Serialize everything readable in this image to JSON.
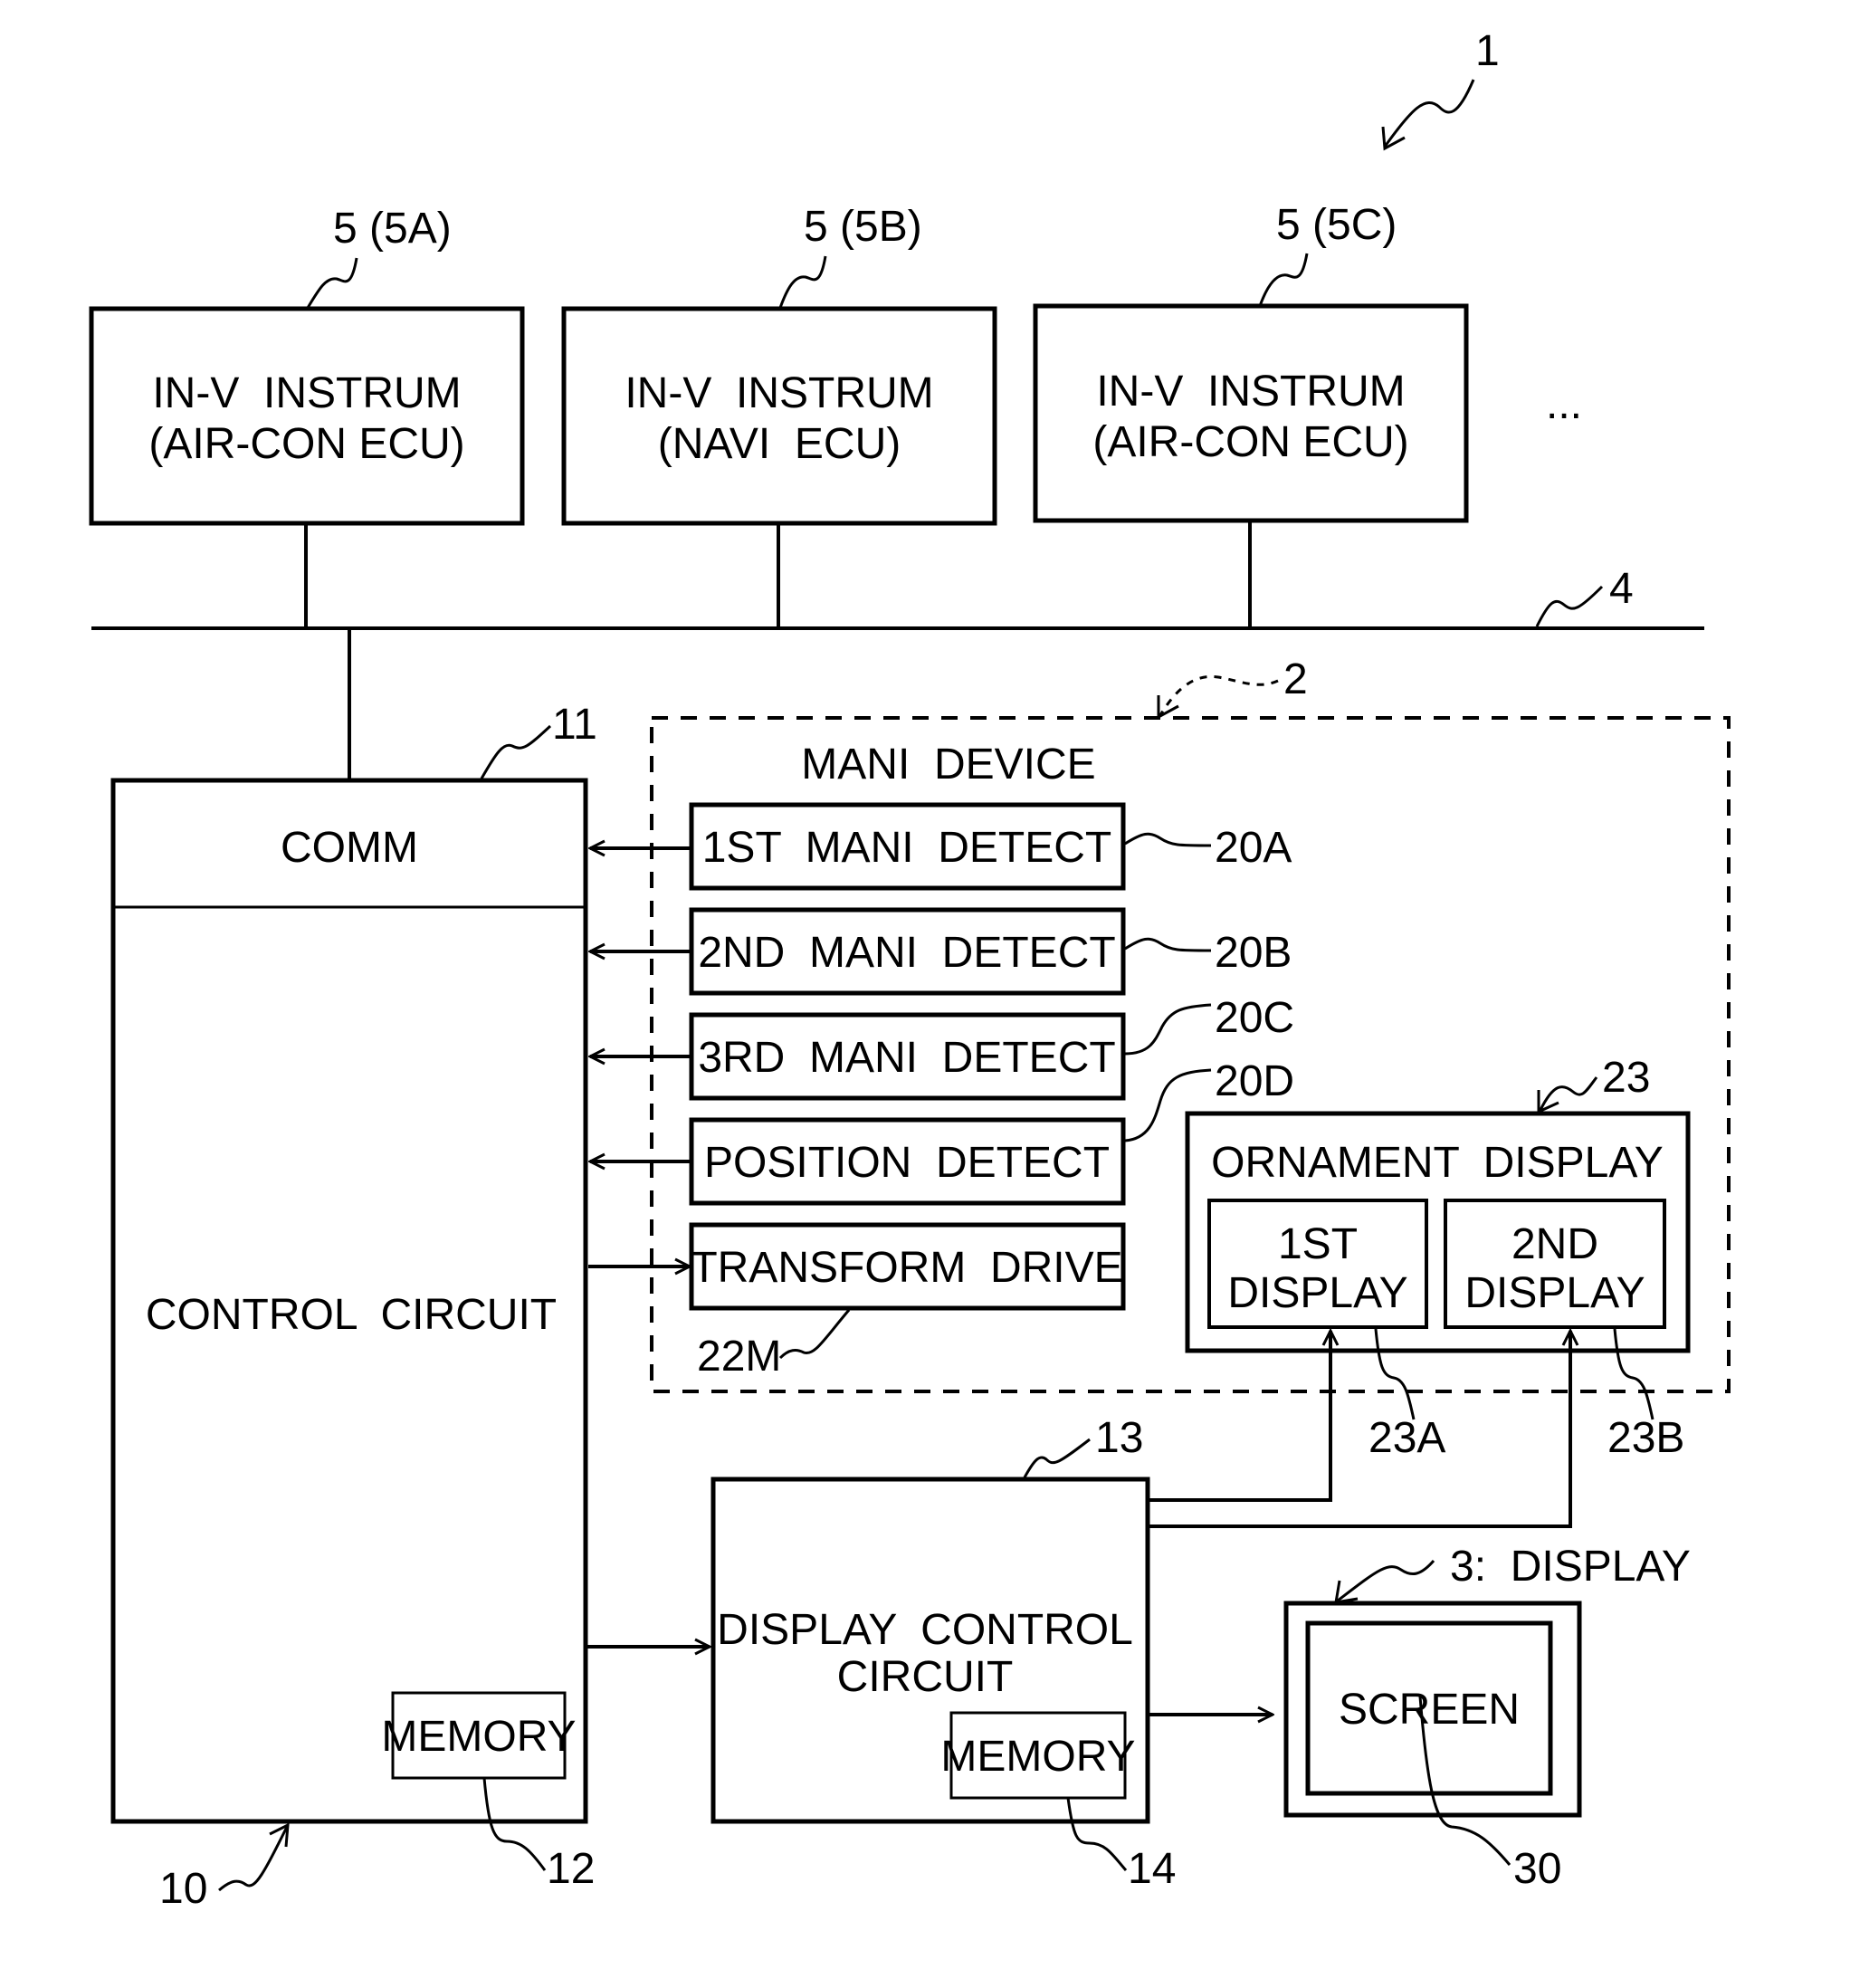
{
  "figure": {
    "system_ref": "1",
    "bus_ref": "4",
    "manip_device_ref": "2",
    "ellipsis": "..."
  },
  "instruments": [
    {
      "ref": "5 (5A)",
      "line1": "IN-V  INSTRUM",
      "line2": "(AIR-CON ECU)"
    },
    {
      "ref": "5 (5B)",
      "line1": "IN-V  INSTRUM",
      "line2": "(NAVI  ECU)"
    },
    {
      "ref": "5 (5C)",
      "line1": "IN-V  INSTRUM",
      "line2": "(AIR-CON ECU)"
    }
  ],
  "control": {
    "ref": "10",
    "comm_ref": "11",
    "comm_label": "COMM",
    "label": "CONTROL  CIRCUIT",
    "memory_label": "MEMORY",
    "memory_ref": "12"
  },
  "manip_device": {
    "title": "MANI  DEVICE",
    "blocks": [
      {
        "label": "1ST  MANI  DETECT",
        "ref": "20A"
      },
      {
        "label": "2ND  MANI  DETECT",
        "ref": "20B"
      },
      {
        "label": "3RD  MANI  DETECT",
        "ref": "20C"
      },
      {
        "label": "POSITION  DETECT",
        "ref": "20D"
      },
      {
        "label": "TRANSFORM  DRIVE",
        "ref": "22M"
      }
    ],
    "ornament": {
      "ref": "23",
      "title": "ORNAMENT  DISPLAY",
      "first": {
        "line1": "1ST",
        "line2": "DISPLAY",
        "ref": "23A"
      },
      "second": {
        "line1": "2ND",
        "line2": "DISPLAY",
        "ref": "23B"
      }
    }
  },
  "display_control": {
    "ref": "13",
    "line1": "DISPLAY  CONTROL",
    "line2": "CIRCUIT",
    "memory_label": "MEMORY",
    "memory_ref": "14"
  },
  "display": {
    "ref": "3:  DISPLAY",
    "screen_label": "SCREEN",
    "screen_ref": "30"
  }
}
